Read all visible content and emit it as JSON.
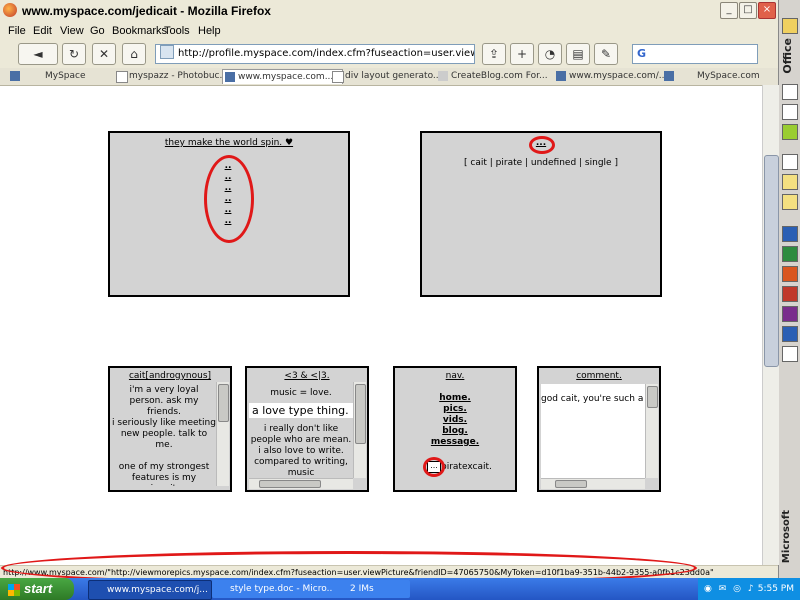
{
  "window": {
    "title": "www.myspace.com/jedicait - Mozilla Firefox",
    "min": "_",
    "max": "□",
    "close": "×"
  },
  "menu": [
    "File",
    "Edit",
    "View",
    "Go",
    "Bookmarks",
    "Tools",
    "Help"
  ],
  "toolbar": {
    "back": "◄",
    "forward": "►",
    "reload": "↻",
    "stop": "✕",
    "home": "⌂",
    "url": "http://profile.myspace.com/index.cfm?fuseaction=user.viewprofile&fri",
    "search_logo": "G"
  },
  "tabs": [
    {
      "label": "MySpace",
      "active": false
    },
    {
      "label": "myspazz - Photobuc...",
      "active": false
    },
    {
      "label": "www.myspace.com...",
      "active": true
    },
    {
      "label": "div layout generato...",
      "active": false
    },
    {
      "label": "CreateBlog.com For...",
      "active": false
    },
    {
      "label": "www.myspace.com/...",
      "active": false
    },
    {
      "label": "MySpace.com",
      "active": false
    }
  ],
  "profile": {
    "box1_header": "they make the world spin. ♥",
    "box1_dots": [
      "..",
      "..",
      "..",
      "..",
      "..",
      ".."
    ],
    "box2_header": "...",
    "box2_info": "[ cait | pirate | undefined | single ]"
  },
  "panels": {
    "about": {
      "header": "cait[androgynous]",
      "lines": [
        "i'm a very loyal person. ask my friends.",
        "i seriously like meeting new people. talk to me.",
        "",
        "one of my strongest features is my passion. i'm an extremely romantic person, though that isn't"
      ]
    },
    "likes": {
      "header": "<3 & <|3.",
      "line1": "music = love.",
      "highlight": "a love type thing.",
      "lines": [
        "i really don't like people who are mean.",
        "i also love to write.",
        "compared to writing, music"
      ]
    },
    "nav": {
      "header": "nav.",
      "links": [
        "home.",
        "pics.",
        "vids.",
        "blog.",
        "message."
      ],
      "badge": "...",
      "name": "piratexcait."
    },
    "comment": {
      "header": "comment.",
      "text": "god cait, you're such a pirat"
    }
  },
  "status": {
    "text": "http://www.myspace.com/\"http://viewmorepics.myspace.com/index.cfm?fuseaction=user.viewPicture&friendID=47065750&MyToken=d10f1ba9-351b-44b2-9355-a0fb1c23dd0a\""
  },
  "office": {
    "label": "Office",
    "brand": "Microsoft"
  },
  "taskbar": {
    "start": "start",
    "tasks": [
      "www.myspace.com/j...",
      "style type.doc - Micro...",
      "2 IMs"
    ],
    "clock": "5:55 PM"
  },
  "colors": {
    "highlight_circle": "#e01818",
    "box_bg": "#d3d3d3",
    "taskbar": "#2456c4"
  }
}
